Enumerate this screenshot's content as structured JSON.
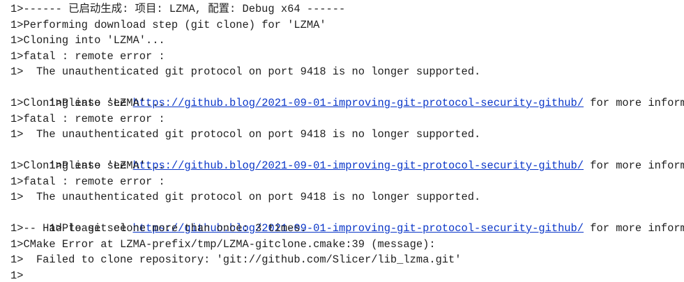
{
  "output": {
    "text_color": "#1e1e1e",
    "link_color": "#0a36c8",
    "lines": [
      {
        "text": "1>------ 已启动生成: 项目: LZMA, 配置: Debug x64 ------"
      },
      {
        "text": "1>Performing download step (git clone) for 'LZMA'"
      },
      {
        "text": "1>Cloning into 'LZMA'..."
      },
      {
        "text": "1>fatal : remote error :"
      },
      {
        "text": "1>  The unauthenticated git protocol on port 9418 is no longer supported."
      },
      {
        "prefix": "1>Please see ",
        "link": "https://github.blog/2021-09-01-improving-git-protocol-security-github/",
        "suffix": " for more information."
      },
      {
        "text": "1>Cloning into 'LZMA'..."
      },
      {
        "text": "1>fatal : remote error :"
      },
      {
        "text": "1>  The unauthenticated git protocol on port 9418 is no longer supported."
      },
      {
        "prefix": "1>Please see ",
        "link": "https://github.blog/2021-09-01-improving-git-protocol-security-github/",
        "suffix": " for more information."
      },
      {
        "text": "1>Cloning into 'LZMA'..."
      },
      {
        "text": "1>fatal : remote error :"
      },
      {
        "text": "1>  The unauthenticated git protocol on port 9418 is no longer supported."
      },
      {
        "prefix": "1>Please see ",
        "link": "https://github.blog/2021-09-01-improving-git-protocol-security-github/",
        "suffix": " for more information."
      },
      {
        "text": "1>-- Had to git clone more than once: 3 times."
      },
      {
        "text": "1>CMake Error at LZMA-prefix/tmp/LZMA-gitclone.cmake:39 (message):"
      },
      {
        "text": "1>  Failed to clone repository: 'git://github.com/Slicer/lib_lzma.git'"
      },
      {
        "text": "1>"
      }
    ]
  }
}
